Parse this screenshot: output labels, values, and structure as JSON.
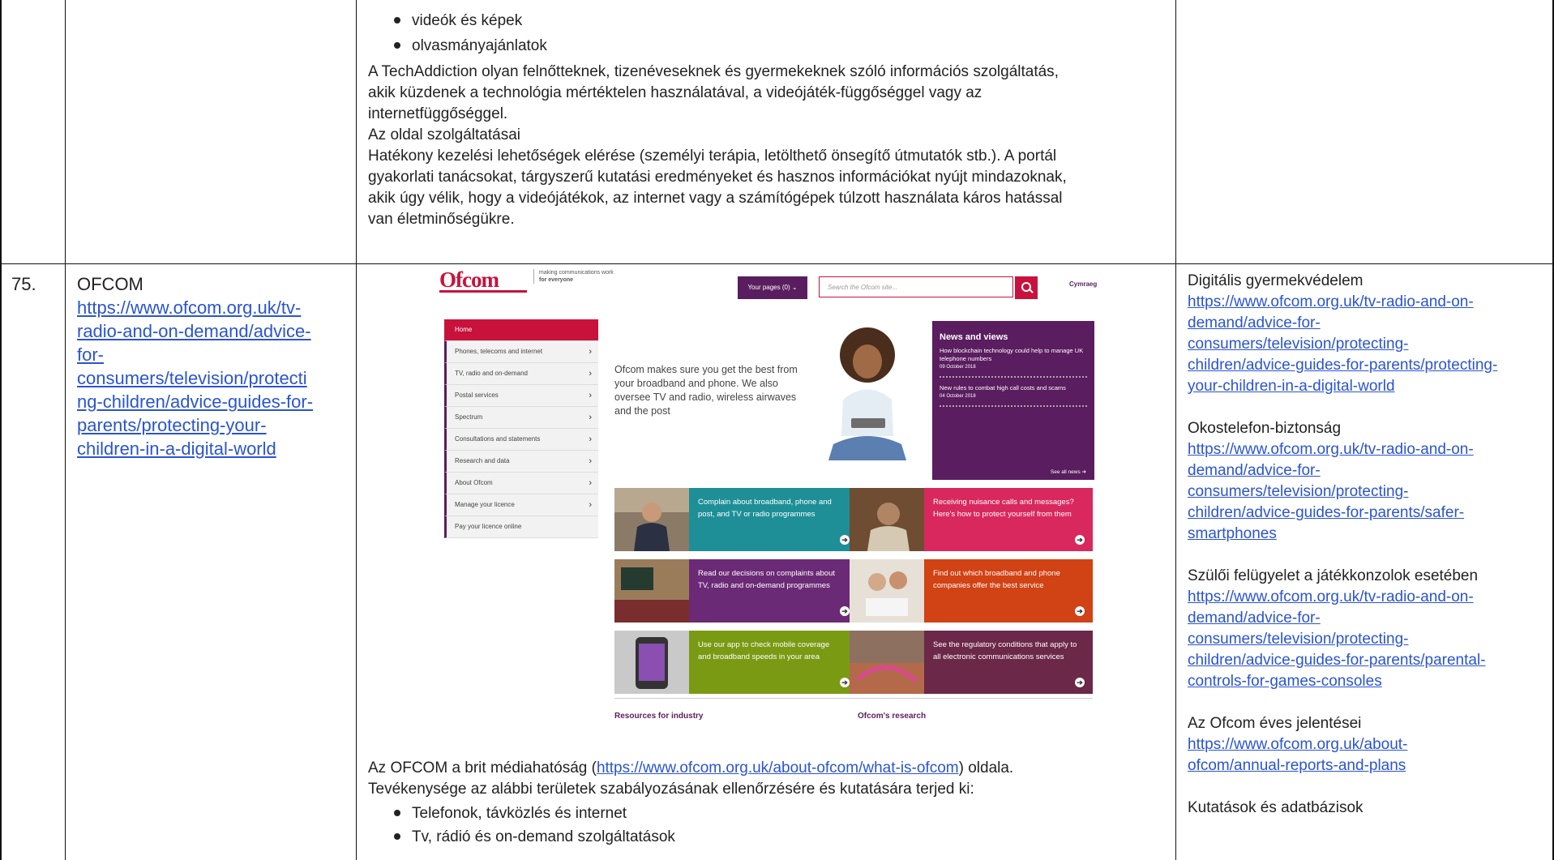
{
  "row1": {
    "bullets": [
      "videók és képek",
      "olvasmányajánlatok"
    ],
    "paragraph1": [
      "A TechAddiction olyan felnőtteknek, tizenéveseknek és gyermekeknek szóló információs szolgáltatás,",
      "akik küzdenek a technológia mértéktelen használatával, a videójáték-függőséggel vagy az",
      "internetfüggőséggel."
    ],
    "subheading": "Az oldal szolgáltatásai",
    "paragraph2": [
      "Hatékony kezelési lehetőségek elérése (személyi terápia, letölthető önsegítő útmutatók stb.). A portál",
      "gyakorlati tanácsokat, tárgyszerű kutatási eredményeket és hasznos információkat nyújt mindazoknak,",
      "akik úgy vélik, hogy a videójátékok, az internet vagy a számítógépek túlzott használata káros hatással",
      "van életminőségükre."
    ]
  },
  "row2": {
    "number": "75.",
    "name": "OFCOM",
    "url_lines": [
      "https://www.ofcom.org.uk/tv-",
      "radio-and-on-demand/advice-",
      "for-",
      "consumers/television/protecti",
      "ng-children/advice-guides-for-",
      "parents/protecting-your-",
      "children-in-a-digital-world"
    ],
    "screenshot": {
      "logo": "Ofcom",
      "tagline_1": "making communications work",
      "tagline_2": "for everyone",
      "your_pages": "Your pages (0)",
      "search_placeholder": "Search the Ofcom site...",
      "cymraeg": "Cymraeg",
      "nav": [
        "Home",
        "Phones, telecoms and internet",
        "TV, radio and on-demand",
        "Postal services",
        "Spectrum",
        "Consultations and statements",
        "Research and data",
        "About Ofcom",
        "Manage your licence",
        "Pay your licence online"
      ],
      "hero": "Ofcom makes sure you get the best from your broadband and phone. We also oversee TV and radio, wireless airwaves and the post",
      "news_title": "News and views",
      "news1": "How blockchain technology could help to manage UK telephone numbers",
      "news1_date": "09 October 2018",
      "news2": "New rules to combat high call costs and scams",
      "news2_date": "04 October 2018",
      "see_all": "See all news",
      "tiles": [
        "Complain about broadband, phone and post, and TV or radio programmes",
        "Receiving nuisance calls and messages? Here's how to protect yourself from them",
        "Read our decisions on complaints about TV, radio and on-demand programmes",
        "Find out which broadband and phone companies offer the best service",
        "Use our app to check mobile coverage and broadband speeds in your area",
        "See the regulatory conditions that apply to all electronic communications services"
      ],
      "resources": "Resources for industry",
      "research": "Ofcom's research"
    },
    "desc_line1_pre": "Az OFCOM a brit médiahatóság (",
    "desc_link": "https://www.ofcom.org.uk/about-ofcom/what-is-ofcom",
    "desc_line1_post": ") oldala.",
    "desc_line2": "Tevékenysége az alábbi területek szabályozásának ellenőrzésére és kutatására terjed ki:",
    "bullets": [
      "Telefonok, távközlés és internet",
      "Tv, rádió és on-demand szolgáltatások"
    ],
    "resources": [
      {
        "title": "Digitális gyermekvédelem",
        "lines": [
          "https://www.ofcom.org.uk/tv-radio-and-on-",
          "demand/advice-for-",
          "consumers/television/protecting-",
          "children/advice-guides-for-parents/protecting-",
          "your-children-in-a-digital-world"
        ]
      },
      {
        "title": "Okostelefon-biztonság",
        "lines": [
          "https://www.ofcom.org.uk/tv-radio-and-on-",
          "demand/advice-for-",
          "consumers/television/protecting-",
          "children/advice-guides-for-parents/safer-",
          "smartphones"
        ]
      },
      {
        "title": "Szülői felügyelet a játékkonzolok esetében",
        "lines": [
          "https://www.ofcom.org.uk/tv-radio-and-on-",
          "demand/advice-for-",
          "consumers/television/protecting-",
          "children/advice-guides-for-parents/parental-",
          "controls-for-games-consoles"
        ]
      },
      {
        "title": "Az Ofcom éves jelentései",
        "lines": [
          "https://www.ofcom.org.uk/about-",
          "ofcom/annual-reports-and-plans"
        ]
      },
      {
        "title": "Kutatások és adatbázisok",
        "lines": []
      }
    ]
  }
}
